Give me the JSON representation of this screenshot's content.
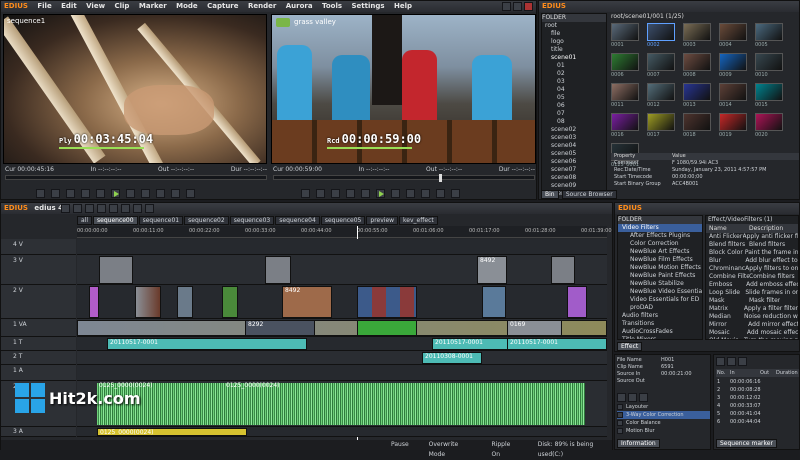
{
  "app": {
    "window_title": "EDIUS",
    "menu": [
      "File",
      "Edit",
      "View",
      "Clip",
      "Marker",
      "Mode",
      "Capture",
      "Render",
      "Aurora",
      "Tools",
      "Settings",
      "Help"
    ]
  },
  "player": {
    "sequence_label": "sequence1",
    "timecode_label": "Ply",
    "timecode": "00:03:45:04",
    "cur": "Cur 00:00:45:16",
    "in": "In --:--:--:--",
    "out": "Out --:--:--:--",
    "dur": "Dur --:--:--:--"
  },
  "recorder": {
    "overlay_text": "grass valley",
    "timecode_label": "Rcd",
    "timecode": "00:00:59:00",
    "cur": "Cur 00:00:59:00",
    "in": "In --:--:--:--",
    "out": "Out --:--:--:--",
    "dur": "Dur --:--:--:--"
  },
  "bin": {
    "title": "EDIUS",
    "folder_header": "FOLDER",
    "path": "root/scene01/001 (1/25)",
    "tree": [
      "root",
      "file",
      "logo",
      "title",
      "scene01",
      "01",
      "02",
      "03",
      "04",
      "05",
      "06",
      "07",
      "08",
      "scene02",
      "scene03",
      "scene04",
      "scene05",
      "scene06",
      "scene07",
      "scene08",
      "scene09",
      "scene10"
    ],
    "thumb_labels": [
      "0001",
      "0002",
      "0003",
      "0004",
      "0005",
      "0006",
      "0007",
      "0008",
      "0009",
      "0010",
      "0011",
      "0012",
      "0013",
      "0014",
      "0015",
      "0016",
      "0017",
      "0018",
      "0019",
      "0020",
      "0125_0001"
    ],
    "props": [
      [
        "Property",
        "Value"
      ],
      [
        "Comment",
        "F 1080/59.94i AC3"
      ],
      [
        "Rec.Date/Time",
        "Sunday, January 23, 2011 4:57:57 PM"
      ],
      [
        "Start Timecode",
        "00:00:00;00"
      ],
      [
        "Start Binary Group",
        "ACC4B001"
      ]
    ],
    "tabs": [
      "Bin",
      "Source Browser"
    ]
  },
  "timeline": {
    "title": "EDIUS",
    "project": "edius 4",
    "tabs": [
      "all",
      "sequence00",
      "sequence01",
      "sequence02",
      "sequence03",
      "sequence04",
      "sequence05",
      "preview",
      "kev_effect"
    ],
    "ruler": [
      "00:00:00:00",
      "00:00:11:00",
      "00:00:22:00",
      "00:00:33:00",
      "00:00:44:00",
      "00:00:55:00",
      "00:01:06:00",
      "00:01:17:00",
      "00:01:28:00",
      "00:01:39:00"
    ],
    "tracks": [
      "4 V",
      "3 V",
      "2 V",
      "1 VA",
      "1 T",
      "2 T",
      "1 A",
      "2 A",
      "3 A"
    ],
    "clip_labels": [
      "8492",
      "8492",
      "0169",
      "0169",
      "8292",
      "8492",
      "20110517-0001",
      "20110517-0001",
      "20110517-0001",
      "20110308-0001",
      "0125_0000(0024)",
      "0125_0000(0024)",
      "0125_0000(0024)"
    ],
    "status": [
      "Pause",
      "Overwrite Mode",
      "Ripple On",
      "Disk: 89% is being used(C:)"
    ]
  },
  "effects": {
    "title": "EDIUS",
    "folder_header": "FOLDER",
    "tree": [
      "Video Filters",
      "After Effects Plugins",
      "Color Correction",
      "NewBlue Art Effects",
      "NewBlue Film Effects",
      "NewBlue Motion Effects",
      "NewBlue Paint Effects",
      "NewBlue Stabilize",
      "NewBlue Video Essentials",
      "Video Essentials for ED",
      "proDAD",
      "Audio filters",
      "Transitions",
      "AudioCrossFades",
      "Title Mixers",
      "Keyers"
    ],
    "path": "Effect/VideoFilters (1)",
    "columns": [
      "Name",
      "Description"
    ],
    "items": [
      [
        "Anti Flicker",
        "Apply anti flicker filter"
      ],
      [
        "Blend filters",
        "Blend filters"
      ],
      [
        "Block Color",
        "Paint the frame in a"
      ],
      [
        "Blur",
        "Add blur effect to a"
      ],
      [
        "Chrominance",
        "Apply filters to only"
      ],
      [
        "Combine Filters",
        "Combine filters"
      ],
      [
        "Emboss",
        "Add emboss effect"
      ],
      [
        "Loop Slide",
        "Slide frames in one"
      ],
      [
        "Mask",
        "Mask filter"
      ],
      [
        "Matrix",
        "Apply a filter filter to"
      ],
      [
        "Median",
        "Noise reduction with"
      ],
      [
        "Mirror",
        "Add mirror effect"
      ],
      [
        "Mosaic",
        "Add mosaic effect"
      ],
      [
        "Old Movie",
        "Turn the moving pict"
      ]
    ],
    "tab": "Effect"
  },
  "info": {
    "props": [
      [
        "File Name",
        "H001"
      ],
      [
        "Clip Name",
        "6591"
      ],
      [
        "Source In",
        "00:00:21:00"
      ],
      [
        "Source Out",
        ""
      ]
    ],
    "layers": [
      "Layouter",
      "3-Way Color Correction",
      "Color Balance",
      "Motion Blur"
    ],
    "tab": "Information"
  },
  "markers": {
    "columns": [
      "No.",
      "In",
      "Out",
      "Duration"
    ],
    "rows": [
      [
        "1",
        "00:00:06:16",
        "",
        ""
      ],
      [
        "2",
        "00:00:08:28",
        "",
        ""
      ],
      [
        "3",
        "00:00:12:02",
        "",
        ""
      ],
      [
        "4",
        "00:00:33:07",
        "",
        ""
      ],
      [
        "5",
        "00:00:41:04",
        "",
        ""
      ],
      [
        "6",
        "00:00:44:04",
        "",
        ""
      ]
    ],
    "tab": "Sequence marker"
  },
  "watermark": {
    "text": "Hit2k.com"
  }
}
